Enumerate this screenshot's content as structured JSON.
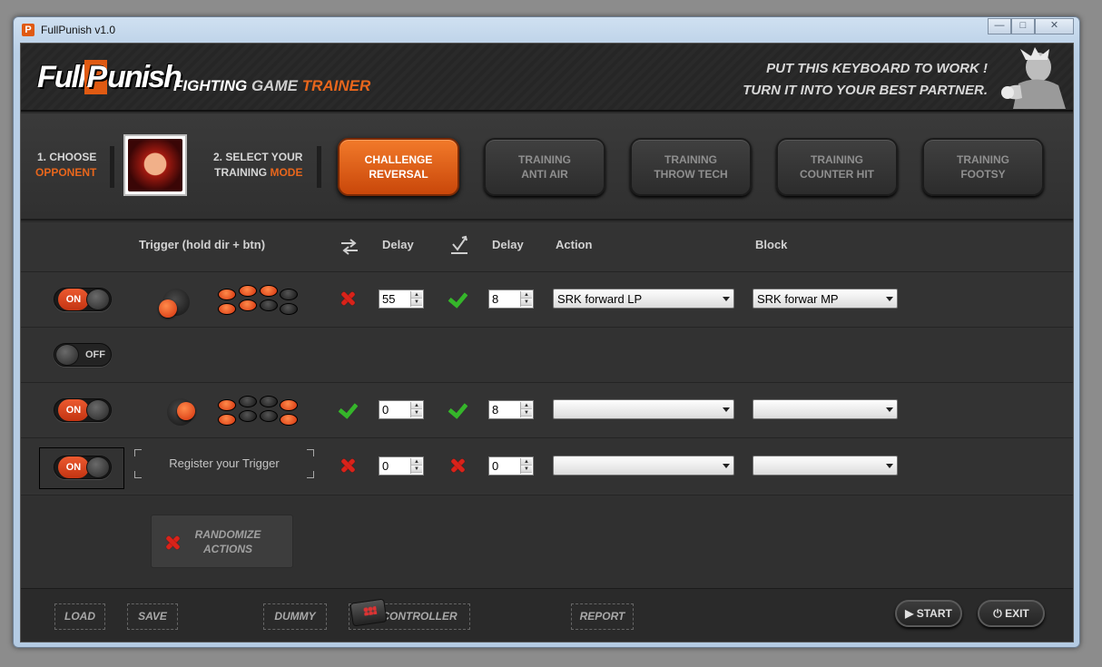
{
  "window": {
    "title": "FullPunish v1.0",
    "icon_letter": "P",
    "minimize": "—",
    "maximize": "□",
    "close": "✕"
  },
  "header": {
    "logo_full": "Full",
    "logo_p": "P",
    "logo_unish": "unish",
    "tagline_1": "FIGHTING",
    "tagline_2": "GAME",
    "tagline_3": "TRAINER",
    "slogan_line1": "PUT THIS KEYBOARD TO WORK !",
    "slogan_line2": "TURN IT INTO YOUR BEST PARTNER."
  },
  "selection": {
    "step1_line1": "1. CHOOSE",
    "step1_line2": "OPPONENT",
    "step2_line1": "2. SELECT YOUR",
    "step2_line2a": "TRAINING",
    "step2_line2b": "MODE",
    "modes": [
      {
        "line1": "CHALLENGE",
        "line2": "REVERSAL",
        "active": true
      },
      {
        "line1": "TRAINING",
        "line2": "ANTI AIR",
        "active": false
      },
      {
        "line1": "TRAINING",
        "line2": "THROW TECH",
        "active": false
      },
      {
        "line1": "TRAINING",
        "line2": "COUNTER HIT",
        "active": false
      },
      {
        "line1": "TRAINING",
        "line2": "FOOTSY",
        "active": false
      }
    ]
  },
  "table": {
    "headers": {
      "trigger": "Trigger (hold dir + btn)",
      "delay1": "Delay",
      "delay2": "Delay",
      "action": "Action",
      "block": "Block"
    },
    "rows": [
      {
        "toggle": "ON",
        "delay1": "55",
        "delay2": "8",
        "action": "SRK forward LP",
        "block": "SRK forwar MP"
      },
      {
        "toggle": "OFF"
      },
      {
        "toggle": "ON",
        "delay1": "0",
        "delay2": "8",
        "action": "",
        "block": ""
      },
      {
        "toggle": "ON",
        "register": "Register your Trigger",
        "delay1": "0",
        "delay2": "0",
        "action": "",
        "block": ""
      }
    ]
  },
  "randomize": {
    "line1": "RANDOMIZE",
    "line2": "ACTIONS"
  },
  "footer": {
    "load": "LOAD",
    "save": "SAVE",
    "dummy": "DUMMY",
    "controller": "CONTROLLER",
    "report": "REPORT",
    "start": "START",
    "exit": "EXIT"
  },
  "colors": {
    "accent": "#e8661c",
    "toggle_on": "#d8401a",
    "check": "#35b52a",
    "cross": "#d8231a"
  }
}
